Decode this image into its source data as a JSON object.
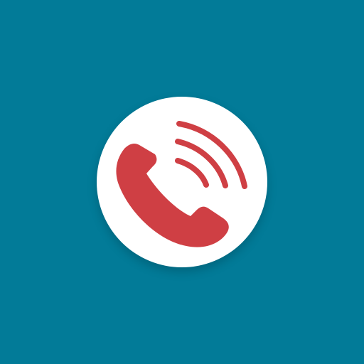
{
  "app": {
    "icon_name": "phone-call-icon",
    "background_color": "#027b98",
    "circle_color": "#ffffff",
    "accent_color": "#cf3f44"
  }
}
